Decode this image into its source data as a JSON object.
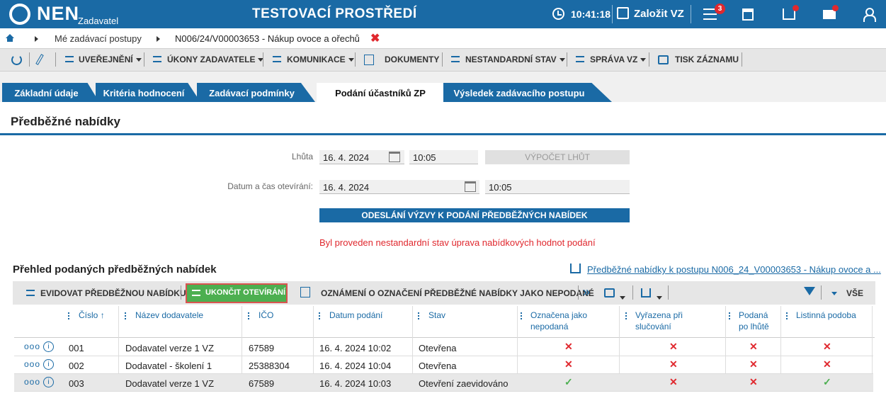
{
  "header": {
    "logo": "NEN",
    "logo_sub": "Zadavatel",
    "environment": "TESTOVACÍ PROSTŘEDÍ",
    "clock": "10:41:18",
    "create_label": "Založit VZ",
    "menu_badge": "3",
    "accent_color": "#1a6aa5"
  },
  "breadcrumb": {
    "item1": "Mé zadávací postupy",
    "item2": "N006/24/V00003653 - Nákup ovoce a ořechů",
    "close": "✖"
  },
  "toolbar": {
    "publish": "UVEŘEJNĚNÍ",
    "actions": "ÚKONY ZADAVATELE",
    "communication": "KOMUNIKACE",
    "documents": "DOKUMENTY",
    "nonstandard": "NESTANDARDNÍ STAV",
    "management": "SPRÁVA VZ",
    "print": "TISK ZÁZNAMU"
  },
  "tabs": [
    {
      "label": "Základní údaje"
    },
    {
      "label": "Kritéria hodnocení"
    },
    {
      "label": "Zadávací podmínky"
    },
    {
      "label": "Podání účastníků ZP"
    },
    {
      "label": "Výsledek zadávacího postupu"
    }
  ],
  "section": {
    "title": "Předběžné nabídky",
    "deadline_label": "Lhůta",
    "deadline_date": "16. 4. 2024",
    "deadline_time": "10:05",
    "calc_button": "VÝPOČET LHŮT",
    "opening_label": "Datum a čas otevírání:",
    "opening_date": "16. 4. 2024",
    "opening_time": "10:05",
    "send_button": "ODESLÁNÍ VÝZVY K PODÁNÍ PŘEDBĚŽNÝCH NABÍDEK",
    "warning": "Byl proveden nestandardní stav úprava nabídkových hodnot podání"
  },
  "overview": {
    "title": "Přehled podaných předběžných nabídek",
    "link": "Předběžné nabídky k postupu N006_24_V00003653 - Nákup ovoce a ...",
    "register_button": "EVIDOVAT PŘEDBĚŽNOU NABÍDKU",
    "end_button": "UKONČIT OTEVÍRÁNÍ",
    "notice_button": "OZNÁMENÍ O OZNAČENÍ PŘEDBĚŽNÉ NABÍDKY JAKO NEPODANÉ",
    "more": "»",
    "all": "VŠE"
  },
  "table": {
    "headers": {
      "number": "Číslo",
      "sort": "↑",
      "supplier": "Název dodavatele",
      "ico": "IČO",
      "date": "Datum podání",
      "state": "Stav",
      "unsubmitted_1": "Označena jako",
      "unsubmitted_2": "nepodaná",
      "excluded_1": "Vyřazena při",
      "excluded_2": "slučování",
      "late_1": "Podaná",
      "late_2": "po lhůtě",
      "paper": "Listinná podoba"
    },
    "rows": [
      {
        "number": "001",
        "supplier": "Dodavatel verze 1 VZ",
        "ico": "67589",
        "date": "16. 4. 2024 10:02",
        "state": "Otevřena",
        "unsubmitted": "✕",
        "excluded": "✕",
        "late": "✕",
        "paper": "✕"
      },
      {
        "number": "002",
        "supplier": "Dodavatel - školení 1",
        "ico": "25388304",
        "date": "16. 4. 2024 10:04",
        "state": "Otevřena",
        "unsubmitted": "✕",
        "excluded": "✕",
        "late": "✕",
        "paper": "✕"
      },
      {
        "number": "003",
        "supplier": "Dodavatel verze 1 VZ",
        "ico": "67589",
        "date": "16. 4. 2024 10:03",
        "state": "Otevření zaevidováno",
        "unsubmitted": "✓",
        "excluded": "✕",
        "late": "✕",
        "paper": "✓"
      }
    ]
  }
}
